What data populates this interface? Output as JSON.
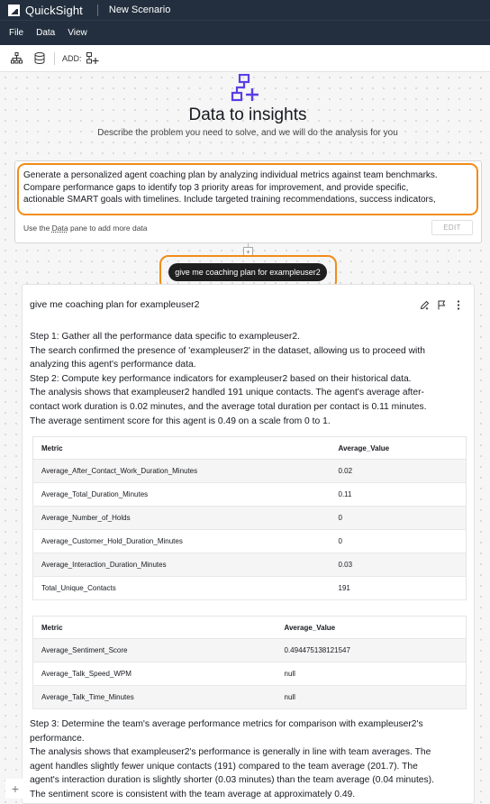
{
  "app": {
    "name": "QuickSight",
    "scenario": "New Scenario"
  },
  "menu": [
    "File",
    "Data",
    "View"
  ],
  "toolbar": {
    "add_label": "ADD:"
  },
  "hero": {
    "title": "Data to insights",
    "subtitle": "Describe the problem you need to solve, and we will do the analysis for you"
  },
  "prompt": {
    "lines": [
      "Generate a personalized agent coaching plan by analyzing individual metrics against team benchmarks.",
      "Compare performance gaps to identify top 3 priority areas for improvement, and provide specific,",
      "actionable SMART goals with timelines. Include targeted training recommendations, success indicators,"
    ],
    "hint_prefix": "Use the ",
    "hint_link": "Data",
    "hint_suffix": " pane to add more data",
    "edit_label": "EDIT"
  },
  "query": {
    "text": "give me coaching plan for exampleuser2"
  },
  "answer": {
    "title": "give me coaching plan for exampleuser2",
    "para1": [
      "Step 1: Gather all the performance data specific to exampleuser2.",
      "The search confirmed the presence of 'exampleuser2' in the dataset, allowing us to proceed with",
      "analyzing this agent's performance data.",
      "Step 2: Compute key performance indicators for exampleuser2 based on their historical data.",
      "The analysis shows that exampleuser2 handled 191 unique contacts. The agent's average after-",
      "contact work duration is 0.02 minutes, and the average total duration per contact is 0.11 minutes.",
      "The average sentiment score for this agent is 0.49 on a scale from 0 to 1."
    ],
    "table1": {
      "headers": [
        "Metric",
        "Average_Value"
      ],
      "rows": [
        [
          "Average_After_Contact_Work_Duration_Minutes",
          "0.02"
        ],
        [
          "Average_Total_Duration_Minutes",
          "0.11"
        ],
        [
          "Average_Number_of_Holds",
          "0"
        ],
        [
          "Average_Customer_Hold_Duration_Minutes",
          "0"
        ],
        [
          "Average_Interaction_Duration_Minutes",
          "0.03"
        ],
        [
          "Total_Unique_Contacts",
          "191"
        ]
      ]
    },
    "table2": {
      "headers": [
        "Metric",
        "Average_Value"
      ],
      "rows": [
        [
          "Average_Sentiment_Score",
          "0.494475138121547"
        ],
        [
          "Average_Talk_Speed_WPM",
          "null"
        ],
        [
          "Average_Talk_Time_Minutes",
          "null"
        ]
      ]
    },
    "para2": [
      "Step 3: Determine the team's average performance metrics for comparison with exampleuser2's",
      "performance.",
      "The analysis shows that exampleuser2's performance is generally in line with team averages. The",
      "agent handles slightly fewer unique contacts (191) compared to the team average (201.7). The",
      "agent's interaction duration is slightly shorter (0.03 minutes) than the team average (0.04 minutes).",
      "The sentiment score is consistent with the team average at approximately 0.49."
    ]
  },
  "colors": {
    "nav_bg": "#232f3e",
    "highlight": "#f08c1a",
    "hero_icon": "#5a3fe6"
  }
}
